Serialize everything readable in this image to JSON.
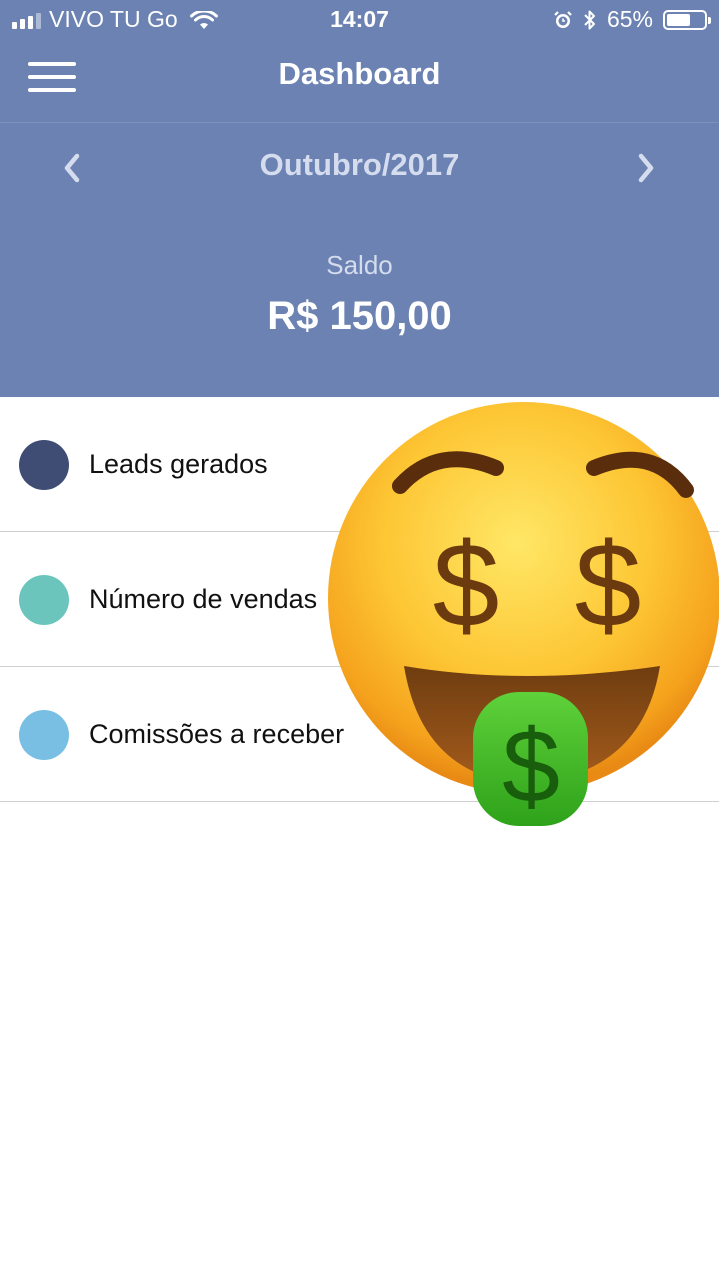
{
  "status_bar": {
    "carrier": "VIVO TU Go",
    "time": "14:07",
    "battery_percent": "65%",
    "battery_level": 0.65,
    "icons": [
      "signal-icon",
      "wifi-icon",
      "alarm-icon",
      "bluetooth-icon",
      "battery-icon"
    ]
  },
  "nav": {
    "title": "Dashboard",
    "menu_icon": "hamburger-menu-icon"
  },
  "period": {
    "label": "Outubro/2017",
    "prev_icon": "chevron-left-icon",
    "next_icon": "chevron-right-icon"
  },
  "balance": {
    "label": "Saldo",
    "value": "R$ 150,00"
  },
  "metrics": [
    {
      "label": "Leads gerados",
      "color": "#3f4d75"
    },
    {
      "label": "Número de vendas",
      "color": "#6cc5bd"
    },
    {
      "label": "Comissões a receber",
      "color": "#78bfe3"
    }
  ],
  "sticker": {
    "icon": "money-mouth-face-emoji"
  },
  "colors": {
    "header_bg": "#6b82b2",
    "accent_text": "#d5dcee"
  }
}
